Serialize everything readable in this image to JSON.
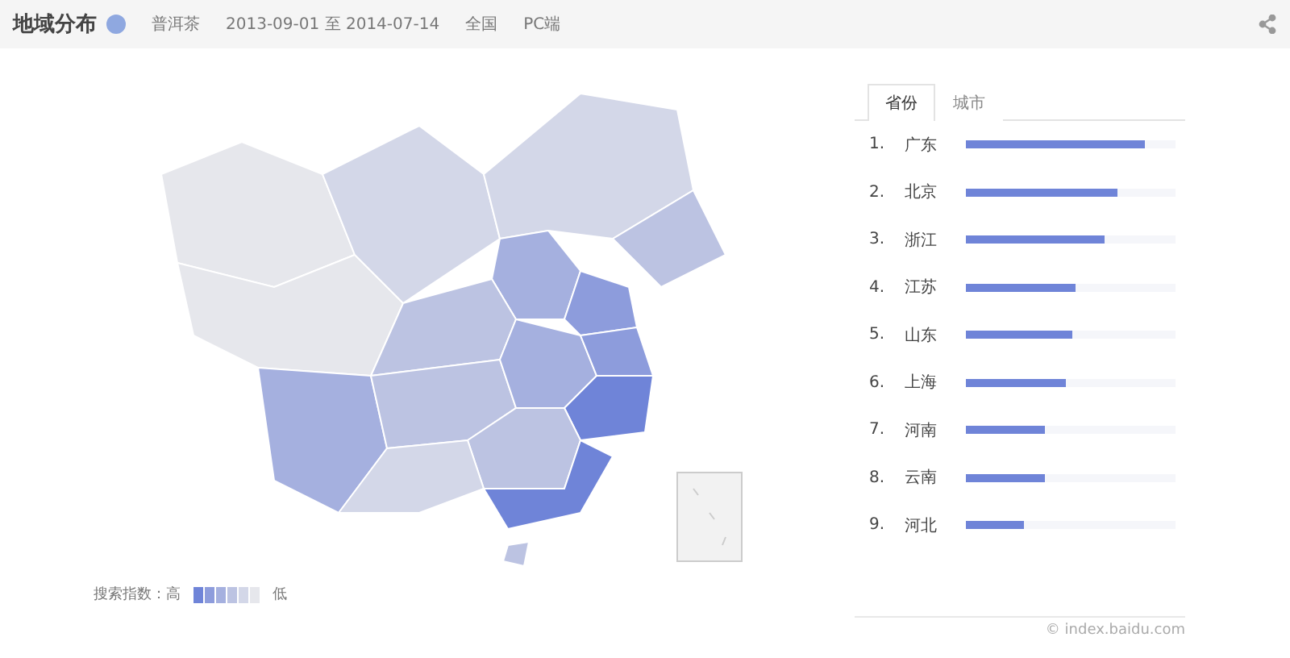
{
  "header": {
    "title": "地域分布",
    "keyword": "普洱茶",
    "date_range": "2013-09-01 至 2014-07-14",
    "region": "全国",
    "platform": "PC端"
  },
  "tabs": [
    {
      "label": "省份",
      "selected": true
    },
    {
      "label": "城市",
      "selected": false
    }
  ],
  "ranking": [
    {
      "rank": "1.",
      "name": "广东",
      "level": 0.85
    },
    {
      "rank": "2.",
      "name": "北京",
      "level": 0.72
    },
    {
      "rank": "3.",
      "name": "浙江",
      "level": 0.66
    },
    {
      "rank": "4.",
      "name": "江苏",
      "level": 0.52
    },
    {
      "rank": "5.",
      "name": "山东",
      "level": 0.51
    },
    {
      "rank": "6.",
      "name": "上海",
      "level": 0.48
    },
    {
      "rank": "7.",
      "name": "河南",
      "level": 0.38
    },
    {
      "rank": "8.",
      "name": "云南",
      "level": 0.38
    },
    {
      "rank": "9.",
      "name": "河北",
      "level": 0.28
    }
  ],
  "legend": {
    "label": "搜索指数：高",
    "low": "低"
  },
  "footer": "© index.baidu.com"
}
